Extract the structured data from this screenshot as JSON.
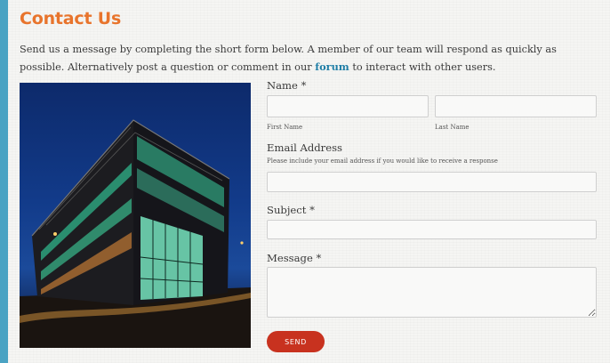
{
  "page": {
    "title": "Contact Us",
    "intro_before_link": "Send us a message by completing the short form below. A member of our team will respond as quickly as possible. Alternatively post a question or comment in our ",
    "intro_link": "forum",
    "intro_after_link": " to interact with other users."
  },
  "form": {
    "name_label": "Name *",
    "first_name_label": "First Name",
    "last_name_label": "Last Name",
    "first_name_value": "",
    "last_name_value": "",
    "email_label": "Email Address",
    "email_hint": "Please include your email address if you would like to receive a response",
    "email_value": "",
    "subject_label": "Subject *",
    "subject_value": "",
    "message_label": "Message *",
    "message_value": "",
    "send_label": "SEND"
  },
  "colors": {
    "outer_background": "#4aa3c3",
    "title": "#e8742c",
    "link": "#1f7ea6",
    "send_button": "#c8321f"
  }
}
